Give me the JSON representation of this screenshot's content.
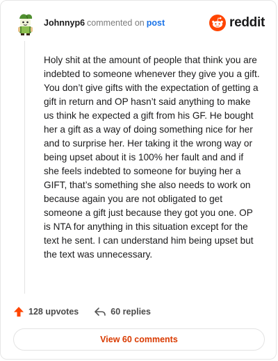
{
  "comment": {
    "username": "Johnnyp6",
    "commented_text": "commented on",
    "post_link": "post",
    "body": "Holy shit at the amount of people that think you are indebted to someone whenever they give you a gift. You don’t give gifts with the expectation of getting a gift in return and OP hasn’t said anything to make us think he expected a gift from his GF. He bought her a gift as a way of doing something nice for her and to surprise her. Her taking it the wrong way or being upset about it is 100% her fault and and if she feels indebted to someone for buying her a GIFT, that’s something she also needs to work on because again you are not obligated to get someone a gift just because they got you one. OP is NTA for anything in this situation except for the text he sent. I can understand him being upset but the text was unnecessary."
  },
  "brand": {
    "wordmark": "reddit",
    "icon": "reddit-logo-icon",
    "color": "#ff4500"
  },
  "actions": {
    "upvotes": "128 upvotes",
    "upvote_icon": "upvote-arrow-icon",
    "upvote_color": "#ff4500",
    "replies": "60 replies",
    "reply_icon": "reply-arrow-icon"
  },
  "view_button": {
    "label": "View 60 comments",
    "color": "#d93a00"
  },
  "colors": {
    "link": "#1a73e8",
    "muted": "#7c7c7c"
  }
}
